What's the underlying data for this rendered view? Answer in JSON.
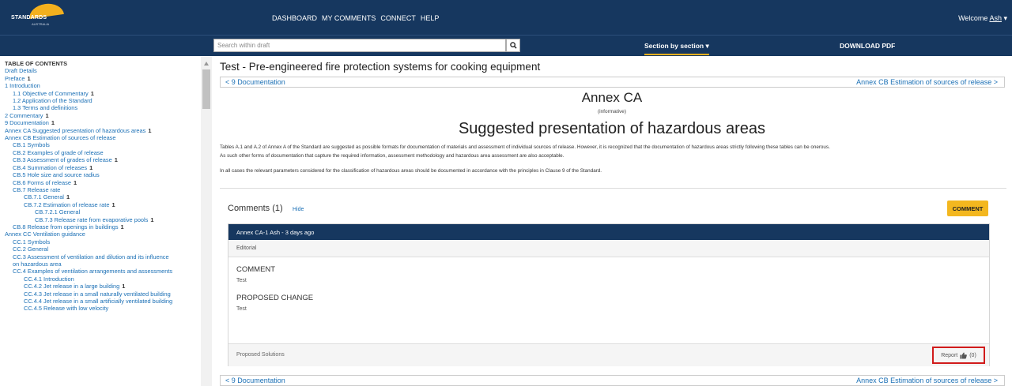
{
  "header": {
    "logo_text": "STANDARDS",
    "logo_sub": "AUSTRALIA",
    "nav": [
      "DASHBOARD",
      "MY COMMENTS",
      "CONNECT",
      "HELP"
    ],
    "welcome_prefix": "Welcome",
    "welcome_user": "Ash",
    "caret": "▾"
  },
  "toolbar": {
    "search_placeholder": "Search within draft",
    "section_mode": "Section by section ▾",
    "download": "DOWNLOAD PDF"
  },
  "toc": {
    "title": "TABLE OF CONTENTS",
    "items": [
      {
        "label": "Draft Details",
        "indent": 0,
        "count": ""
      },
      {
        "label": "Preface",
        "indent": 0,
        "count": "1"
      },
      {
        "label": "1 Introduction",
        "indent": 0,
        "count": ""
      },
      {
        "label": "1.1 Objective of Commentary",
        "indent": 1,
        "count": "1"
      },
      {
        "label": "1.2 Application of the Standard",
        "indent": 1,
        "count": ""
      },
      {
        "label": "1.3 Terms and definitions",
        "indent": 1,
        "count": ""
      },
      {
        "label": "2 Commentary",
        "indent": 0,
        "count": "1"
      },
      {
        "label": "9 Documentation",
        "indent": 0,
        "count": "1"
      },
      {
        "label": "Annex CA Suggested presentation of hazardous areas",
        "indent": 0,
        "count": "1"
      },
      {
        "label": "Annex CB Estimation of sources of release",
        "indent": 0,
        "count": ""
      },
      {
        "label": "CB.1 Symbols",
        "indent": 1,
        "count": ""
      },
      {
        "label": "CB.2 Examples of grade of release",
        "indent": 1,
        "count": ""
      },
      {
        "label": "CB.3 Assessment of grades of release",
        "indent": 1,
        "count": "1"
      },
      {
        "label": "CB.4 Summation of releases",
        "indent": 1,
        "count": "1"
      },
      {
        "label": "CB.5 Hole size and source radius",
        "indent": 1,
        "count": ""
      },
      {
        "label": "CB.6 Forms of release",
        "indent": 1,
        "count": "1"
      },
      {
        "label": "CB.7 Release rate",
        "indent": 1,
        "count": ""
      },
      {
        "label": "CB.7.1 General",
        "indent": 2,
        "count": "1"
      },
      {
        "label": "CB.7.2 Estimation of release rate",
        "indent": 2,
        "count": "1"
      },
      {
        "label": "CB.7.2.1 General",
        "indent": 3,
        "count": ""
      },
      {
        "label": "CB.7.3 Release rate from evaporative pools",
        "indent": 3,
        "count": "1"
      },
      {
        "label": "CB.8 Release from openings in buildings",
        "indent": 1,
        "count": "1"
      },
      {
        "label": "Annex CC Ventilation guidance",
        "indent": 0,
        "count": ""
      },
      {
        "label": "CC.1 Symbols",
        "indent": 1,
        "count": ""
      },
      {
        "label": "CC.2 General",
        "indent": 1,
        "count": ""
      },
      {
        "label": "CC.3 Assessment of ventilation and dilution and its influence",
        "indent": 1,
        "count": ""
      },
      {
        "label": "on hazardous area",
        "indent": 1,
        "count": ""
      },
      {
        "label": "CC.4 Examples of ventilation arrangements and assessments",
        "indent": 1,
        "count": ""
      },
      {
        "label": "CC.4.1 Introduction",
        "indent": 2,
        "count": ""
      },
      {
        "label": "CC.4.2 Jet release in a large building",
        "indent": 2,
        "count": "1"
      },
      {
        "label": "CC.4.3 Jet release in a small naturally ventilated building",
        "indent": 2,
        "count": ""
      },
      {
        "label": "CC.4.4 Jet release in a small artificially ventilated building",
        "indent": 2,
        "count": ""
      },
      {
        "label": "CC.4.5 Release with low velocity",
        "indent": 2,
        "count": ""
      }
    ]
  },
  "main": {
    "doc_title": "Test - Pre-engineered fire protection systems for cooking equipment",
    "prev_link": "< 9 Documentation",
    "next_link": "Annex CB Estimation of sources of release >",
    "annex_title": "Annex CA",
    "annex_sub": "(informative)",
    "annex_heading": "Suggested presentation of hazardous areas",
    "para1": "Tables A.1 and A.2 of Annex A of the Standard are suggested as possible formats for documentation of materials and assessment of individual sources of release. However, it is recognized that the documentation of hazardous areas strictly following these tables can be onerous.",
    "para2": "As such other forms of documentation that capture the required information, assessment methodology and hazardous area assessment are also acceptable.",
    "para3": "In all cases the relevant parameters considered for the classification of hazardous areas should be documented in accordance with the principles in Clause 9 of the Standard."
  },
  "comments": {
    "title": "Comments (1)",
    "hide": "Hide",
    "add_button": "COMMENT",
    "card": {
      "header": "Annex CA-1 Ash - 3 days ago",
      "category": "Editorial",
      "comment_label": "COMMENT",
      "comment_value": "Test",
      "change_label": "PROPOSED CHANGE",
      "change_value": "Test",
      "proposed_solutions": "Proposed Solutions",
      "report": "Report",
      "likes": "(0)"
    }
  },
  "colors": {
    "nav_bg": "#16375f",
    "accent": "#f3b71f",
    "link": "#1a6fb5",
    "highlight": "#d11b1b"
  }
}
